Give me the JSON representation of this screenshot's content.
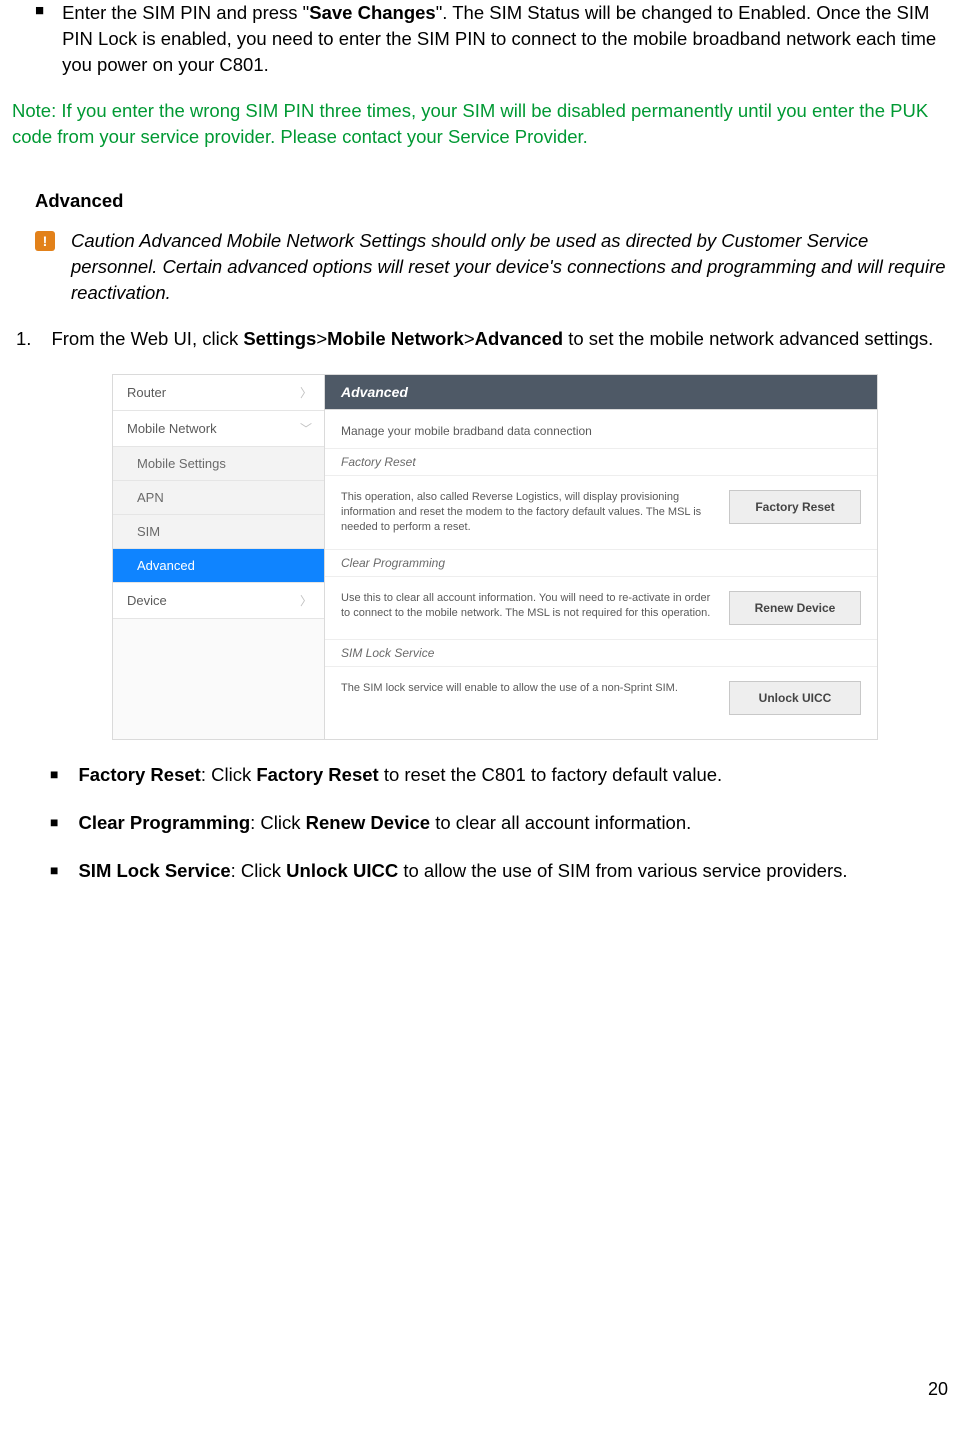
{
  "intro": {
    "bullet_pre": "Enter the SIM PIN and press \"",
    "bullet_bold": "Save Changes",
    "bullet_post": "\". The SIM Status will be changed to Enabled. Once the SIM PIN Lock is enabled, you need to enter the SIM PIN to connect to the mobile broadband network each time you power on your C801."
  },
  "note": "Note: If you enter the wrong SIM PIN three times, your SIM will be disabled permanently until you enter the PUK code from your service provider. Please contact your Service Provider.",
  "advanced_heading": "Advanced",
  "caution_badge": "!",
  "caution_text": "Caution Advanced Mobile Network Settings should only be used as directed by Customer Service personnel. Certain advanced options will reset your device's connections and programming and will require reactivation.",
  "step1": {
    "num": "1.",
    "pre": "From the Web UI, click ",
    "b1": "Settings",
    "sep1": ">",
    "b2": "Mobile Network",
    "sep2": ">",
    "b3": "Advanced",
    "post": " to set the mobile network advanced settings."
  },
  "screenshot": {
    "nav": {
      "router": "Router",
      "mobile_network": "Mobile Network",
      "mobile_settings": "Mobile Settings",
      "apn": "APN",
      "sim": "SIM",
      "advanced": "Advanced",
      "device": "Device"
    },
    "pane": {
      "header": "Advanced",
      "desc": "Manage your mobile bradband data connection",
      "section1_title": "Factory Reset",
      "section1_text": "This operation, also called Reverse Logistics, will display provisioning information and reset the modem to the factory default values. The MSL is needed to perform a reset.",
      "section1_btn": "Factory Reset",
      "section2_title": "Clear Programming",
      "section2_text": "Use this to clear all account information. You will need to re-activate in order to connect to the mobile network. The MSL is not required for this operation.",
      "section2_btn": "Renew Device",
      "section3_title": "SIM Lock Service",
      "section3_text": "The SIM lock service will enable to allow the use of a non-Sprint SIM.",
      "section3_btn": "Unlock UICC"
    }
  },
  "list": {
    "i1_b1": "Factory Reset",
    "i1_mid": ": Click ",
    "i1_b2": "Factory Reset",
    "i1_post": " to reset the C801 to factory default value.",
    "i2_b1": "Clear Programming",
    "i2_mid": ": Click ",
    "i2_b2": "Renew Device",
    "i2_post": " to clear all account information.",
    "i3_b1": "SIM Lock Service",
    "i3_mid": ": Click ",
    "i3_b2": "Unlock UICC",
    "i3_post": " to allow the use of SIM from various service providers."
  },
  "page_number": "20"
}
